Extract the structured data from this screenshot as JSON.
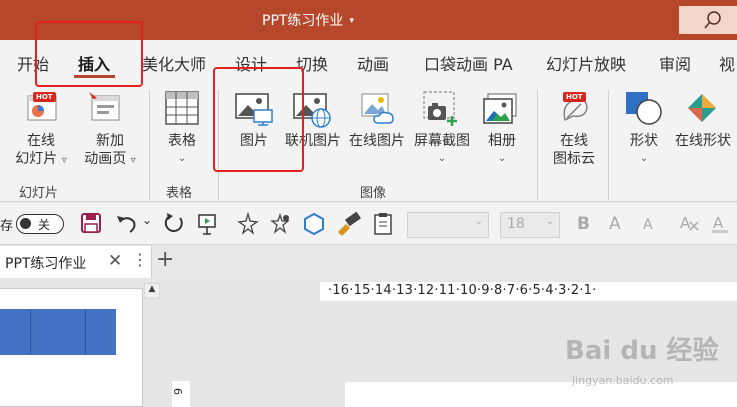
{
  "window": {
    "title": "PPT练习作业",
    "title_caret": "▾"
  },
  "tabs": [
    {
      "label": "开始"
    },
    {
      "label": "插入"
    },
    {
      "label": "美化大师"
    },
    {
      "label": "设计"
    },
    {
      "label": "切换"
    },
    {
      "label": "动画"
    },
    {
      "label": "口袋动画 PA"
    },
    {
      "label": "幻灯片放映"
    },
    {
      "label": "审阅"
    },
    {
      "label": "视"
    }
  ],
  "active_tab": "插入",
  "ribbon": {
    "hot_badge": "HOT",
    "online_slides": {
      "line1": "在线",
      "line2": "幻灯片",
      "dd": "▿"
    },
    "new_anim_page": {
      "line1": "新加",
      "line2": "动画页",
      "dd": "▿"
    },
    "group_slides": "幻灯片",
    "table": {
      "label": "表格",
      "dd": "⌄"
    },
    "group_table": "表格",
    "picture": {
      "label": "图片"
    },
    "online_picture_connected": {
      "label": "联机图片"
    },
    "online_picture": {
      "label": "在线图片"
    },
    "screenshot": {
      "label": "屏幕截图",
      "dd": "⌄"
    },
    "album": {
      "label": "相册",
      "dd": "⌄"
    },
    "group_images": "图像",
    "online_icons": {
      "line1": "在线",
      "line2": "图标云"
    },
    "shapes": {
      "label": "形状",
      "dd": "⌄"
    },
    "online_shapes": {
      "label": "在线形状"
    }
  },
  "qat": {
    "save_label_fragment": "存",
    "toggle_label": "关",
    "undo_dd": "⌄",
    "font_size_value": "18",
    "format_buttons": [
      "B",
      "A",
      "A"
    ]
  },
  "doc_tabs": {
    "active": "PPT练习作业",
    "close": "✕",
    "more": "⋮",
    "add": "+"
  },
  "ruler": {
    "horizontal": "·16·15·14·13·12·11·10·9·8·7·6·5·4·3·2·1·",
    "vertical": "6"
  },
  "watermark": {
    "main": "Bai du 经验",
    "sub": "jingyan.baidu.com"
  },
  "colors": {
    "brand": "#b7472a",
    "highlight": "#e52020",
    "slide_blue": "#4472c4"
  }
}
